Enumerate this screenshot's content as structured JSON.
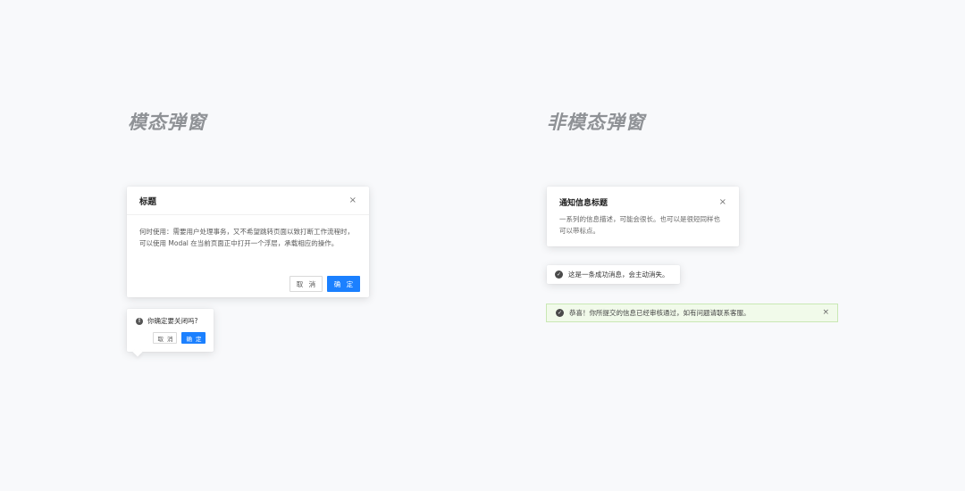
{
  "sections": {
    "modal_title": "模态弹窗",
    "nonmodal_title": "非模态弹窗"
  },
  "modal": {
    "title": "标题",
    "close": "×",
    "body": "何时使用：需要用户处理事务，又不希望跳转页面以致打断工作流程时，可以使用 Modal 在当前页面正中打开一个浮层，承载相应的操作。",
    "cancel_label": "取 消",
    "ok_label": "确 定"
  },
  "popconfirm": {
    "icon": "!",
    "text": "你确定要关闭吗?",
    "cancel_label": "取 消",
    "ok_label": "确 定"
  },
  "notification": {
    "title": "通知信息标题",
    "close": "×",
    "body": "一系列的信息描述，可能会很长。也可以是很短同样也可以带标点。"
  },
  "message": {
    "icon": "✓",
    "text": "这是一条成功消息，会主动消失。"
  },
  "alert": {
    "icon": "✓",
    "text": "恭喜！你所提交的信息已经审核通过，如有问题请联系客服。",
    "close": "×"
  },
  "colors": {
    "primary": "#1b80ff",
    "background": "#f8f9fb",
    "title_gray": "#8f9296",
    "alert_bg": "#f1faea",
    "alert_border": "#c9e8b4"
  }
}
